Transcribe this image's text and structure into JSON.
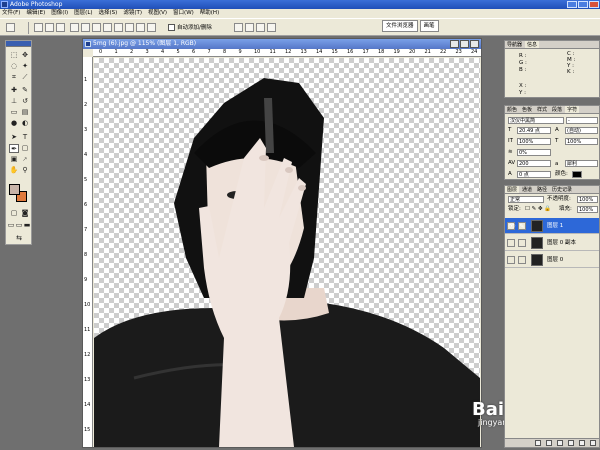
{
  "app": {
    "title": "Adobe Photoshop"
  },
  "menu": [
    "文件(F)",
    "编辑(E)",
    "图像(I)",
    "图层(L)",
    "选择(S)",
    "滤镜(T)",
    "视图(V)",
    "窗口(W)",
    "帮助(H)"
  ],
  "options": {
    "checkbox_label": "自动添加/删除"
  },
  "palette_well": {
    "tab1": "文件浏览器",
    "tab2": "画笔"
  },
  "document": {
    "title": "5mg (6).jpg @ 115% (图层 1, RGB)",
    "ruler_h": [
      "0",
      "1",
      "2",
      "3",
      "4",
      "5",
      "6",
      "7",
      "8",
      "9",
      "10",
      "11",
      "12",
      "13",
      "14",
      "15",
      "16",
      "17",
      "18",
      "19",
      "20",
      "21",
      "22",
      "23",
      "24"
    ],
    "ruler_v": [
      "1",
      "2",
      "3",
      "4",
      "5",
      "6",
      "7",
      "8",
      "9",
      "10",
      "11",
      "12",
      "13",
      "14",
      "15"
    ]
  },
  "info_panel": {
    "tabs": [
      "导航器",
      "信息"
    ],
    "r": "R :",
    "g": "G :",
    "b": "B :",
    "c": "C :",
    "m": "M :",
    "y": "Y :",
    "k": "K :",
    "x": "X :",
    "yy": "Y :"
  },
  "char_panel": {
    "tabs": [
      "颜色",
      "色板",
      "样式",
      "段落",
      "字符"
    ],
    "font": "汉仪中黑简",
    "font_style": "-",
    "size": "20.49 点",
    "leading": "(自动)",
    "scale_v": "100%",
    "scale_h": "100%",
    "tracking": "0%",
    "kerning": "200",
    "baseline": "0 点",
    "color_label": "颜色:",
    "aa": "a",
    "aa_mode": "犀利"
  },
  "layers_panel": {
    "tabs": [
      "图层",
      "通道",
      "路径",
      "历史记录"
    ],
    "blend": "正常",
    "opacity_label": "不透明度:",
    "opacity": "100%",
    "lock_label": "锁定:",
    "fill_label": "填充:",
    "fill": "100%",
    "layers": [
      {
        "name": "图层 1"
      },
      {
        "name": "图层 0 副本"
      },
      {
        "name": "图层 0"
      }
    ]
  },
  "watermark": {
    "logo": "Bai 经验",
    "url": "jingyan.baidu.com"
  },
  "colors": {
    "foreground": "#c8b4a8",
    "background": "#e07a3c",
    "selection": "#2d68d8"
  }
}
